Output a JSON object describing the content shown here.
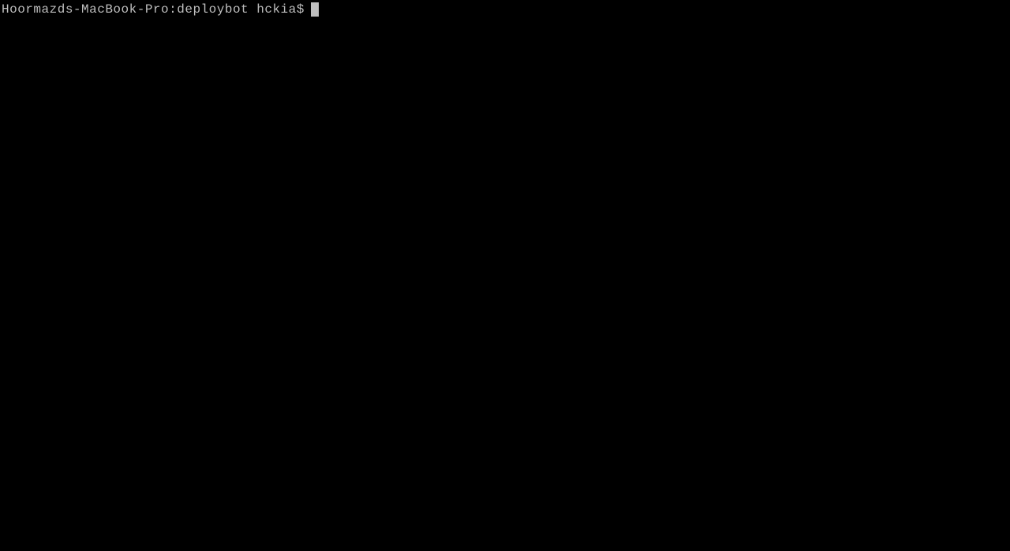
{
  "terminal": {
    "prompt": "Hoormazds-MacBook-Pro:deploybot hckia$",
    "input": ""
  }
}
